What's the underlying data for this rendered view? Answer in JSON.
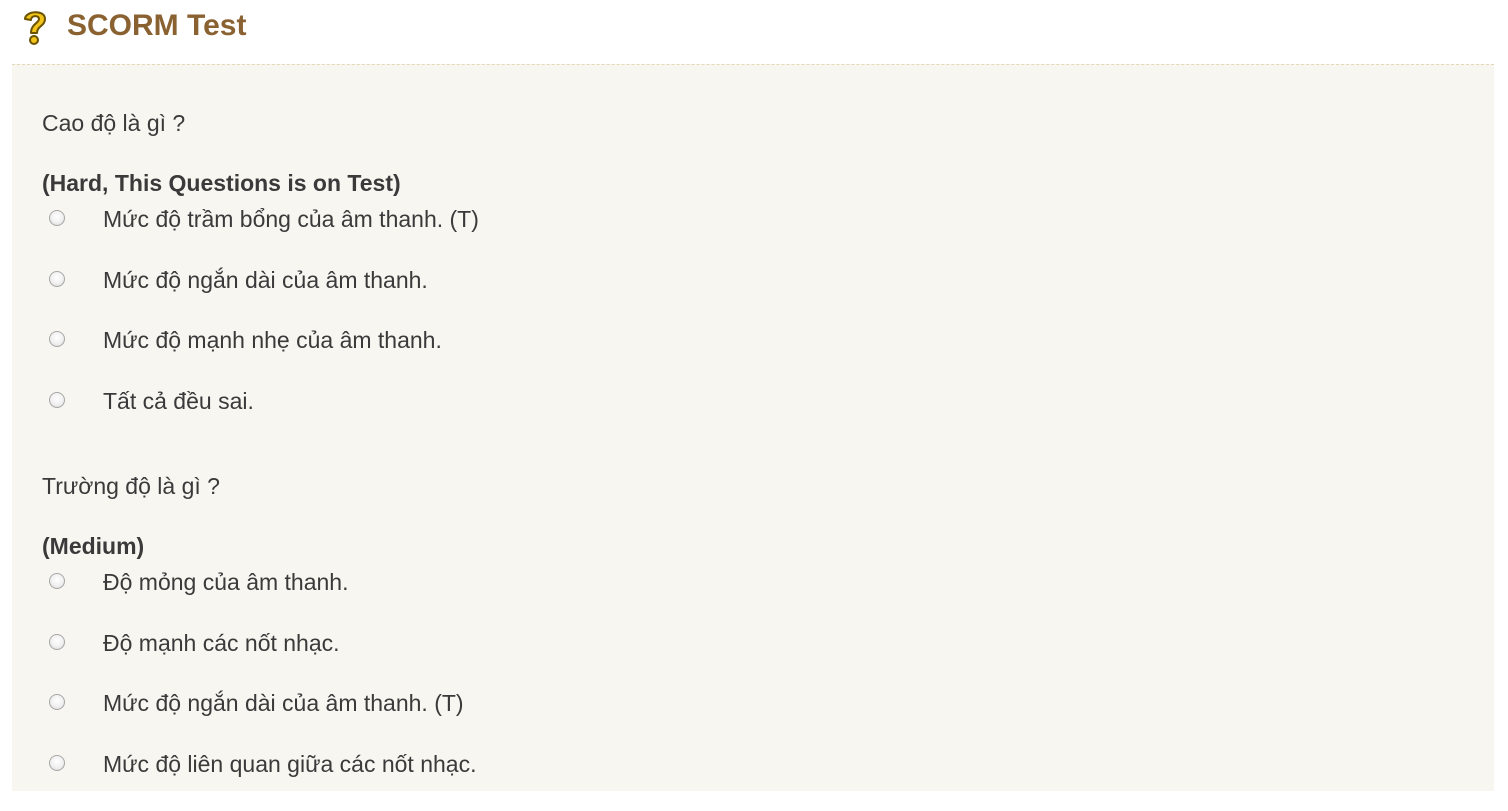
{
  "header": {
    "title": "SCORM Test",
    "icon": "question-mark-icon",
    "icon_color": "#f2c318",
    "title_color": "#8a6232"
  },
  "questions": [
    {
      "text": "Cao độ là gì ?",
      "level": "(Hard, This Questions is on Test)",
      "options": [
        "Mức độ trầm bổng của âm thanh. (T)",
        "Mức độ ngắn dài của âm thanh.",
        "Mức độ mạnh nhẹ của âm thanh.",
        "Tất cả đều sai."
      ]
    },
    {
      "text": "Trường độ là gì ?",
      "level": "(Medium)",
      "options": [
        "Độ mỏng của âm thanh.",
        "Độ mạnh các nốt nhạc.",
        "Mức độ ngắn dài của âm thanh. (T)",
        "Mức độ liên quan giữa các nốt nhạc."
      ]
    }
  ]
}
